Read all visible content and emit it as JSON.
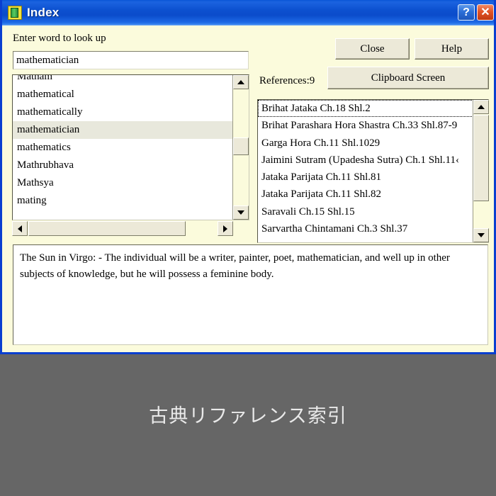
{
  "window": {
    "title": "Index",
    "icon": "book-icon",
    "help_button_glyph": "?",
    "close_button_glyph": "✕",
    "border_color": "#0a3fd0",
    "background_color": "#fbfbdc",
    "titlebar_color": "#0c50cf"
  },
  "form": {
    "prompt_label": "Enter word to look up",
    "search_value": "mathematician",
    "search_placeholder": "Enter word to look up"
  },
  "word_list": {
    "items": [
      {
        "label": "Matham",
        "selected": false
      },
      {
        "label": "mathematical",
        "selected": false
      },
      {
        "label": "mathematically",
        "selected": false
      },
      {
        "label": "mathematician",
        "selected": true
      },
      {
        "label": "mathematics",
        "selected": false
      },
      {
        "label": "Mathrubhava",
        "selected": false
      },
      {
        "label": "Mathsya",
        "selected": false
      },
      {
        "label": "mating",
        "selected": false
      }
    ],
    "scroll_up_icon": "triangle-up-icon",
    "scroll_down_icon": "triangle-down-icon",
    "scroll_left_icon": "triangle-left-icon",
    "scroll_right_icon": "triangle-right-icon",
    "selection_color": "#e8e8dc"
  },
  "buttons": {
    "close": "Close",
    "help": "Help",
    "clipboard_screen": "Clipboard Screen"
  },
  "references": {
    "count_label": "References:9",
    "count": 9,
    "items": [
      {
        "label": "Brihat Jataka Ch.18 Shl.2",
        "focused": true
      },
      {
        "label": "Brihat Parashara Hora Shastra Ch.33 Shl.87-9",
        "focused": false
      },
      {
        "label": "Garga Hora Ch.11 Shl.1029",
        "focused": false
      },
      {
        "label": "Jaimini Sutram (Upadesha Sutra) Ch.1 Shl.11‹",
        "focused": false
      },
      {
        "label": "Jataka Parijata Ch.11 Shl.81",
        "focused": false
      },
      {
        "label": "Jataka Parijata Ch.11 Shl.82",
        "focused": false
      },
      {
        "label": "Saravali Ch.15 Shl.15",
        "focused": false
      },
      {
        "label": "Sarvartha Chintamani Ch.3 Shl.37",
        "focused": false
      }
    ],
    "scroll_up_icon": "triangle-up-icon",
    "scroll_down_icon": "triangle-down-icon"
  },
  "description": {
    "text": "The Sun in Virgo: - The individual will be a writer, painter, poet, mathematician, and well up in other subjects of knowledge, but he will possess a feminine body."
  },
  "caption": {
    "text": "古典リファレンス索引"
  }
}
